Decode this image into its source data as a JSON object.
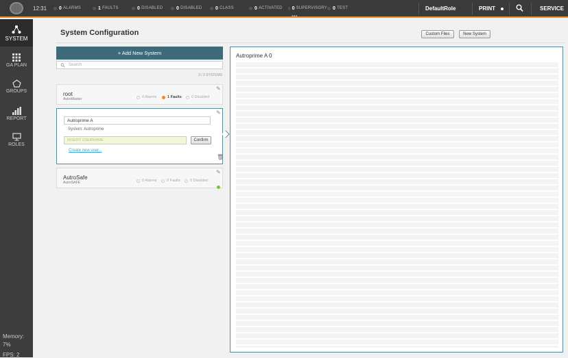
{
  "topbar": {
    "time": "12:31",
    "stats": [
      {
        "count": "0",
        "label": "ALARMS"
      },
      {
        "count": "1",
        "label": "FAULTS"
      },
      {
        "count": "0",
        "label": "DISABLED"
      },
      {
        "count": "0",
        "label": "DISABLED"
      },
      {
        "count": "0",
        "label": "CLASS"
      },
      {
        "count": "0",
        "label": "ACTIVATED"
      },
      {
        "count": "0",
        "label": "SUPERVISORY"
      },
      {
        "count": "0",
        "label": "TEST"
      }
    ],
    "more_indicator": "•••",
    "role": "DefaultRole",
    "print": "PRINT",
    "service": "SERVICE"
  },
  "sidebar": {
    "items": [
      {
        "label": "SYSTEM",
        "icon": "system-icon"
      },
      {
        "label": "GA PLAN",
        "icon": "grid-icon"
      },
      {
        "label": "GROUPS",
        "icon": "groups-icon"
      },
      {
        "label": "REPORT",
        "icon": "report-icon"
      },
      {
        "label": "ROLES",
        "icon": "roles-icon"
      }
    ],
    "memory_label": "Memory:",
    "memory_value": "7%",
    "fps": "FPS: 2"
  },
  "page": {
    "title": "System Configuration",
    "custom_files": "Custom Files",
    "new_system": "New System",
    "add_new_system": "+ Add New System",
    "search_placeholder": "Search",
    "count": "3 / 3 SYSTEMS"
  },
  "systems": [
    {
      "name": "root",
      "sub": "AutroMaster",
      "alarms": "0 Alarms",
      "faults": "1 Faults",
      "disabled": "0 Disabled"
    },
    {
      "name": "AutroSafe",
      "sub": "AutroSAFE",
      "alarms": "0 Alarms",
      "faults": "0 Faults",
      "disabled": "0 Disabled"
    }
  ],
  "edit": {
    "name_value": "Autroprime A",
    "system_line": "System: Autroprime",
    "user_placeholder": "INSERT USERNAME",
    "confirm": "Confirm",
    "create_link": "Create new user..."
  },
  "panel": {
    "title": "Autroprime A 0"
  }
}
